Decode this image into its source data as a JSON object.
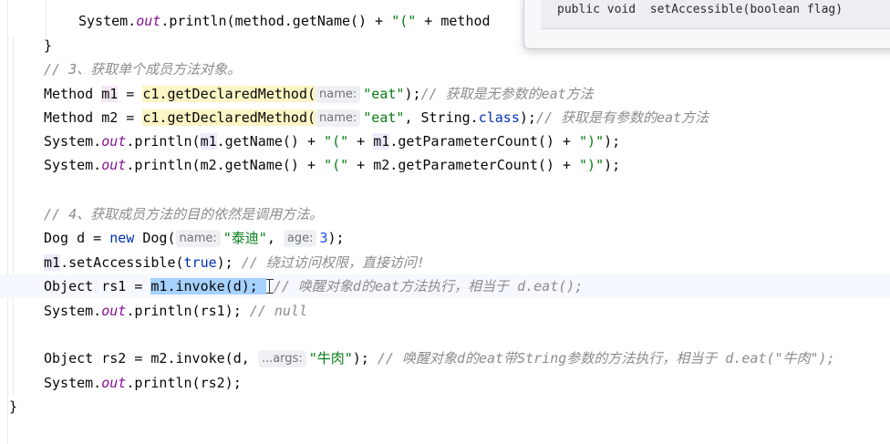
{
  "tooltip": {
    "signature": "public void  setAccessible(boolean flag)"
  },
  "lines": [
    {
      "id": "l1",
      "parts": [
        {
          "t": "System.",
          "c": ""
        },
        {
          "t": "out",
          "c": "fld"
        },
        {
          "t": ".println(method.getName() + ",
          "c": ""
        },
        {
          "t": "\"(\"",
          "c": "str"
        },
        {
          "t": " + method",
          "c": ""
        }
      ]
    },
    {
      "id": "l2",
      "parts": [
        {
          "t": "}",
          "c": ""
        }
      ]
    },
    {
      "id": "l3",
      "parts": [
        {
          "t": "// 3、获取单个成员方法对象。",
          "c": "cmt"
        }
      ]
    },
    {
      "id": "l4",
      "parts": [
        {
          "t": "Method ",
          "c": ""
        },
        {
          "t": "m1",
          "c": "hl-var"
        },
        {
          "t": " = ",
          "c": ""
        },
        {
          "t": "c1.getDeclaredMethod(",
          "c": "hl-method"
        },
        {
          "hint": "name:"
        },
        {
          "t": "\"eat\"",
          "c": "str"
        },
        {
          "t": ");",
          "c": ""
        },
        {
          "t": "// 获取是无参数的eat方法",
          "c": "cmt"
        }
      ]
    },
    {
      "id": "l5",
      "parts": [
        {
          "t": "Method m2 = ",
          "c": ""
        },
        {
          "t": "c1.getDeclaredMethod(",
          "c": "hl-method"
        },
        {
          "hint": "name:"
        },
        {
          "t": "\"eat\"",
          "c": "str"
        },
        {
          "t": ", String.",
          "c": ""
        },
        {
          "t": "class",
          "c": "kw"
        },
        {
          "t": ");",
          "c": ""
        },
        {
          "t": "// 获取是有参数的eat方法",
          "c": "cmt"
        }
      ]
    },
    {
      "id": "l6",
      "parts": [
        {
          "t": "System.",
          "c": ""
        },
        {
          "t": "out",
          "c": "fld"
        },
        {
          "t": ".println(",
          "c": ""
        },
        {
          "t": "m1",
          "c": "hl-var2"
        },
        {
          "t": ".getName() + ",
          "c": ""
        },
        {
          "t": "\"(\"",
          "c": "str"
        },
        {
          "t": " + ",
          "c": ""
        },
        {
          "t": "m1",
          "c": "hl-var2"
        },
        {
          "t": ".getParameterCount() + ",
          "c": ""
        },
        {
          "t": "\")\"",
          "c": "str"
        },
        {
          "t": ");",
          "c": ""
        }
      ]
    },
    {
      "id": "l7",
      "parts": [
        {
          "t": "System.",
          "c": ""
        },
        {
          "t": "out",
          "c": "fld"
        },
        {
          "t": ".println(m2.getName() + ",
          "c": ""
        },
        {
          "t": "\"(\"",
          "c": "str"
        },
        {
          "t": " + m2.getParameterCount() + ",
          "c": ""
        },
        {
          "t": "\")\"",
          "c": "str"
        },
        {
          "t": ");",
          "c": ""
        }
      ]
    },
    {
      "id": "l8",
      "parts": []
    },
    {
      "id": "l9",
      "parts": [
        {
          "t": "// 4、获取成员方法的目的依然是调用方法。",
          "c": "cmt"
        }
      ]
    },
    {
      "id": "l10",
      "parts": [
        {
          "t": "Dog d = ",
          "c": ""
        },
        {
          "t": "new",
          "c": "kw"
        },
        {
          "t": " Dog(",
          "c": ""
        },
        {
          "hint": "name:"
        },
        {
          "t": "\"泰迪\"",
          "c": "str"
        },
        {
          "t": ", ",
          "c": ""
        },
        {
          "hint": "age:"
        },
        {
          "t": "3",
          "c": "num"
        },
        {
          "t": ");",
          "c": ""
        }
      ]
    },
    {
      "id": "l11",
      "parts": [
        {
          "t": "m1",
          "c": "hl-var2"
        },
        {
          "t": ".setAccessible(",
          "c": ""
        },
        {
          "t": "true",
          "c": "kw"
        },
        {
          "t": "); ",
          "c": ""
        },
        {
          "t": "// 绕过访问权限，直接访问!",
          "c": "cmt"
        }
      ]
    },
    {
      "id": "l12",
      "current": true,
      "parts": [
        {
          "t": "Object rs1 = ",
          "c": ""
        },
        {
          "t": "m1.invoke(d); ",
          "c": "sel"
        },
        {
          "caret": true
        },
        {
          "t": "// 唤醒对象d的eat方法执行，相当于 d.eat();",
          "c": "cmt"
        }
      ]
    },
    {
      "id": "l13",
      "parts": [
        {
          "t": "System.",
          "c": ""
        },
        {
          "t": "out",
          "c": "fld"
        },
        {
          "t": ".println(rs1); ",
          "c": ""
        },
        {
          "t": "// null",
          "c": "cmt"
        }
      ]
    },
    {
      "id": "l14",
      "parts": []
    },
    {
      "id": "l15",
      "parts": [
        {
          "t": "Object rs2 = m2.invoke(d, ",
          "c": ""
        },
        {
          "hint": "...args:"
        },
        {
          "t": "\"牛肉\"",
          "c": "str"
        },
        {
          "t": "); ",
          "c": ""
        },
        {
          "t": "// 唤醒对象d的eat带String参数的方法执行，相当于 d.eat(\"牛肉\");",
          "c": "cmt"
        }
      ]
    },
    {
      "id": "l16",
      "parts": [
        {
          "t": "System.",
          "c": ""
        },
        {
          "t": "out",
          "c": "fld"
        },
        {
          "t": ".println(rs2);",
          "c": ""
        }
      ]
    },
    {
      "id": "l17",
      "parts": [
        {
          "t": "}",
          "c": ""
        }
      ]
    }
  ]
}
